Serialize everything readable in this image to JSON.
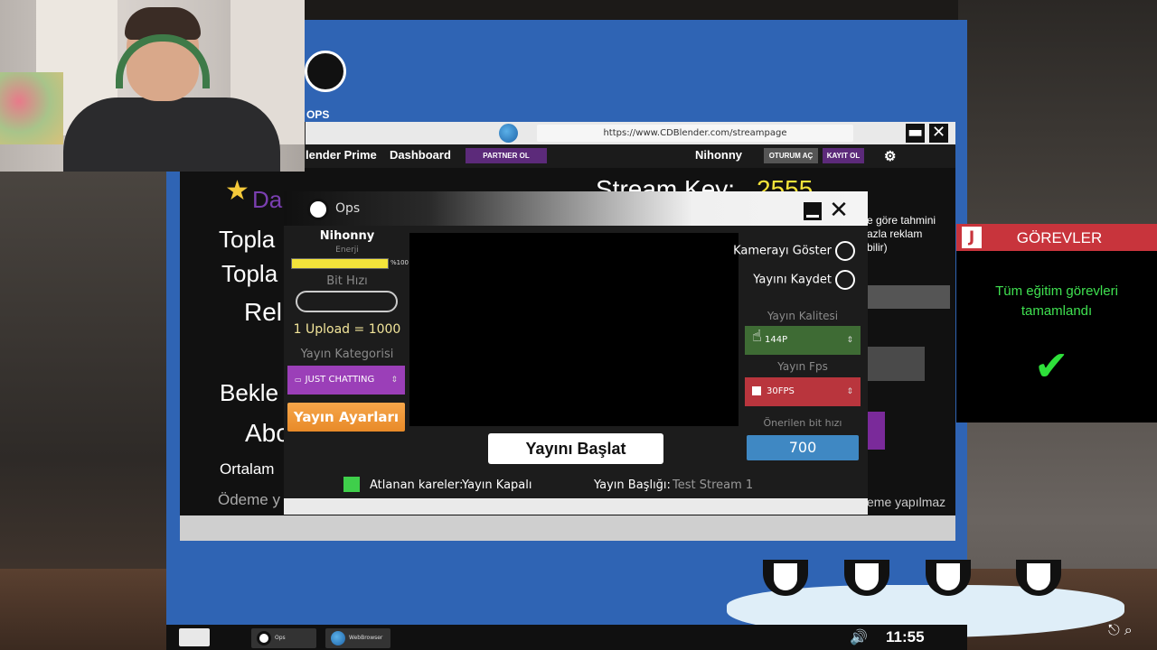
{
  "desktop": {
    "icon_label": "OPS"
  },
  "browser": {
    "url": "https://www.CDBlender.com/streampage",
    "min_glyph": "▬",
    "close_glyph": "✕",
    "nav": {
      "brand": "lender Prime",
      "dashboard": "Dashboard",
      "partner": "PARTNER OL",
      "user": "Nihonny",
      "login": "OTURUM AÇ",
      "register": "KAYIT OL"
    },
    "page": {
      "heading_partial": "Da",
      "stream_key_label": "Stream Key:",
      "stream_key_value": "2555",
      "line1": "Topla",
      "line2": "Topla",
      "line3": "Rel",
      "line4": "Bekle",
      "line5": "Abo",
      "line6": "Ortalam",
      "line7": "Ödeme y",
      "right_text1": "e göre tahmini",
      "right_text2": "azla reklam",
      "right_text3": "bilir)",
      "right_footer": "eme yapılmaz"
    }
  },
  "ops": {
    "title": "Ops",
    "username": "Nihonny",
    "energy_label": "Enerji",
    "energy_pct_text": "%100",
    "energy_level": 1.0,
    "bitrate_label": "Bit Hızı",
    "upload_text": "1 Upload = 1000",
    "category_label": "Yayın Kategorisi",
    "category_value": "JUST CHATTING",
    "settings_button": "Yayın Ayarları",
    "camera_toggle": "Kamerayı Göster",
    "record_toggle": "Yayını Kaydet",
    "quality_label": "Yayın Kalitesi",
    "quality_value": "144P",
    "fps_label": "Yayın Fps",
    "fps_value": "30FPS",
    "suggested_label": "Önerilen bit hızı",
    "suggested_value": "700",
    "start_button": "Yayını Başlat",
    "skipped_label": "Atlanan kareler:",
    "skipped_value": "Yayın Kapalı",
    "stream_title_label": "Yayın Başlığı:",
    "stream_title_value": "Test Stream 1",
    "colors": {
      "category": "#9b3fb8",
      "quality": "#3e6b34",
      "fps": "#b9353d",
      "suggested": "#3f88c3",
      "settings": "#f0962f"
    }
  },
  "tasks": {
    "badge": "J",
    "title": "GÖREVLER",
    "message": "Tüm eğitim görevleri tamamlandı",
    "check_glyph": "✔"
  },
  "taskbar": {
    "items": [
      "Ops",
      "WebBrowser"
    ],
    "clock": "11:55",
    "volume_glyph": "🔊"
  }
}
